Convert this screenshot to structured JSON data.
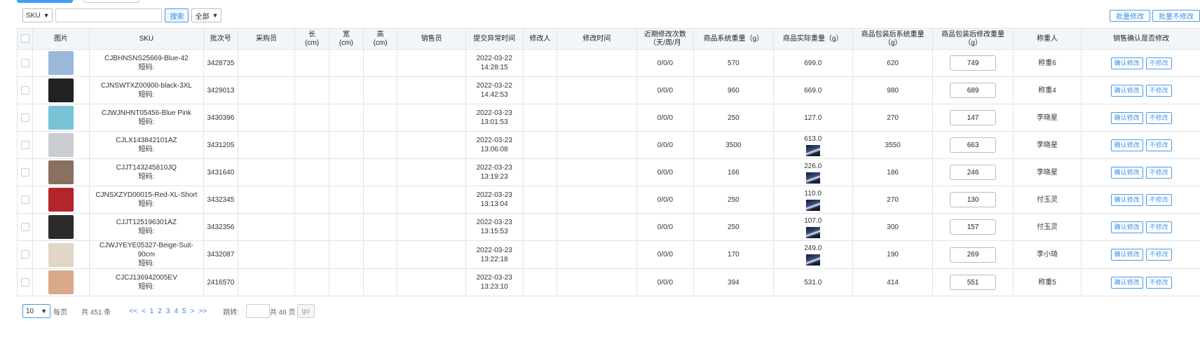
{
  "filter": {
    "field_select": "SKU",
    "search_value": "",
    "search_button": "搜索",
    "scope_select": "全部"
  },
  "batch": {
    "modify": "批量修改",
    "no_modify": "批量不修改"
  },
  "table": {
    "headers": [
      "",
      "图片",
      "SKU",
      "批次号",
      "采购员",
      "长\n(cm)",
      "宽\n(cm)",
      "高\n(cm)",
      "销售员",
      "提交异常时间",
      "修改人",
      "修改时间",
      "近期修改次数（天/周/月",
      "商品系统重量（g）",
      "商品实际重量（g）",
      "商品包装后系统重量（g）",
      "商品包装后修改重量（g）",
      "称重人",
      "销售确认是否修改"
    ],
    "short_code_label": "短码:",
    "confirm_label": "确认修改",
    "reject_label": "不修改",
    "rows": [
      {
        "sku": "CJBHNSNS25669-Blue-42",
        "batch": "3428735",
        "date": "2022-03-22",
        "time": "14:28:15",
        "counts": "0/0/0",
        "sys_weight": "570",
        "actual_weight": "699.0",
        "has_actual_img": false,
        "pkg_sys_weight": "620",
        "pkg_mod_weight": "749",
        "weigher": "称重6",
        "thumb_color": "#9bb7d9"
      },
      {
        "sku": "CJNSWTXZ00900-black-3XL",
        "batch": "3429013",
        "date": "2022-03-22",
        "time": "14:42:53",
        "counts": "0/0/0",
        "sys_weight": "960",
        "actual_weight": "669.0",
        "has_actual_img": false,
        "pkg_sys_weight": "980",
        "pkg_mod_weight": "689",
        "weigher": "称重4",
        "thumb_color": "#222222"
      },
      {
        "sku": "CJWJNHNT05456-Blue Pink",
        "batch": "3430396",
        "date": "2022-03-23",
        "time": "13:01:53",
        "counts": "0/0/0",
        "sys_weight": "250",
        "actual_weight": "127.0",
        "has_actual_img": false,
        "pkg_sys_weight": "270",
        "pkg_mod_weight": "147",
        "weigher": "李晓星",
        "thumb_color": "#79c3d8"
      },
      {
        "sku": "CJLX143842101AZ",
        "batch": "3431205",
        "date": "2022-03-23",
        "time": "13:06:08",
        "counts": "0/0/0",
        "sys_weight": "3500",
        "actual_weight": "613.0",
        "has_actual_img": true,
        "pkg_sys_weight": "3550",
        "pkg_mod_weight": "663",
        "weigher": "李晓星",
        "thumb_color": "#c9ccd1"
      },
      {
        "sku": "CJJT143245810JQ",
        "batch": "3431640",
        "date": "2022-03-23",
        "time": "13:19:23",
        "counts": "0/0/0",
        "sys_weight": "166",
        "actual_weight": "226.0",
        "has_actual_img": true,
        "pkg_sys_weight": "186",
        "pkg_mod_weight": "246",
        "weigher": "李晓星",
        "thumb_color": "#8a7060"
      },
      {
        "sku": "CJNSXZYD00015-Red-XL-Short",
        "batch": "3432345",
        "date": "2022-03-23",
        "time": "13:13:04",
        "counts": "0/0/0",
        "sys_weight": "250",
        "actual_weight": "110.0",
        "has_actual_img": true,
        "pkg_sys_weight": "270",
        "pkg_mod_weight": "130",
        "weigher": "付玉灵",
        "thumb_color": "#b3242b"
      },
      {
        "sku": "CJJT125196301AZ",
        "batch": "3432356",
        "date": "2022-03-23",
        "time": "13:15:53",
        "counts": "0/0/0",
        "sys_weight": "250",
        "actual_weight": "107.0",
        "has_actual_img": true,
        "pkg_sys_weight": "300",
        "pkg_mod_weight": "157",
        "weigher": "付玉灵",
        "thumb_color": "#2b2b2b"
      },
      {
        "sku": "CJWJYEYE05327-Beige-Suit-90cm",
        "batch": "3432087",
        "date": "2022-03-23",
        "time": "13:22:18",
        "counts": "0/0/0",
        "sys_weight": "170",
        "actual_weight": "249.0",
        "has_actual_img": true,
        "pkg_sys_weight": "190",
        "pkg_mod_weight": "269",
        "weigher": "李小琦",
        "thumb_color": "#e2d6c6"
      },
      {
        "sku": "CJCJ136942005EV",
        "batch": "2416570",
        "date": "2022-03-23",
        "time": "13:23:10",
        "counts": "0/0/0",
        "sys_weight": "394",
        "actual_weight": "531.0",
        "has_actual_img": false,
        "pkg_sys_weight": "414",
        "pkg_mod_weight": "551",
        "weigher": "称重5",
        "thumb_color": "#d9a98a"
      }
    ]
  },
  "pagination": {
    "page_size": "10",
    "per_page_label": "每页",
    "total_label": "共 451 条",
    "first": "<<",
    "prev": "<",
    "pages": [
      "1",
      "2",
      "3",
      "4",
      "5"
    ],
    "next": ">",
    "last": ">>",
    "jump_label": "跳转:",
    "total_pages_label": "共 46 页",
    "go": "go"
  }
}
